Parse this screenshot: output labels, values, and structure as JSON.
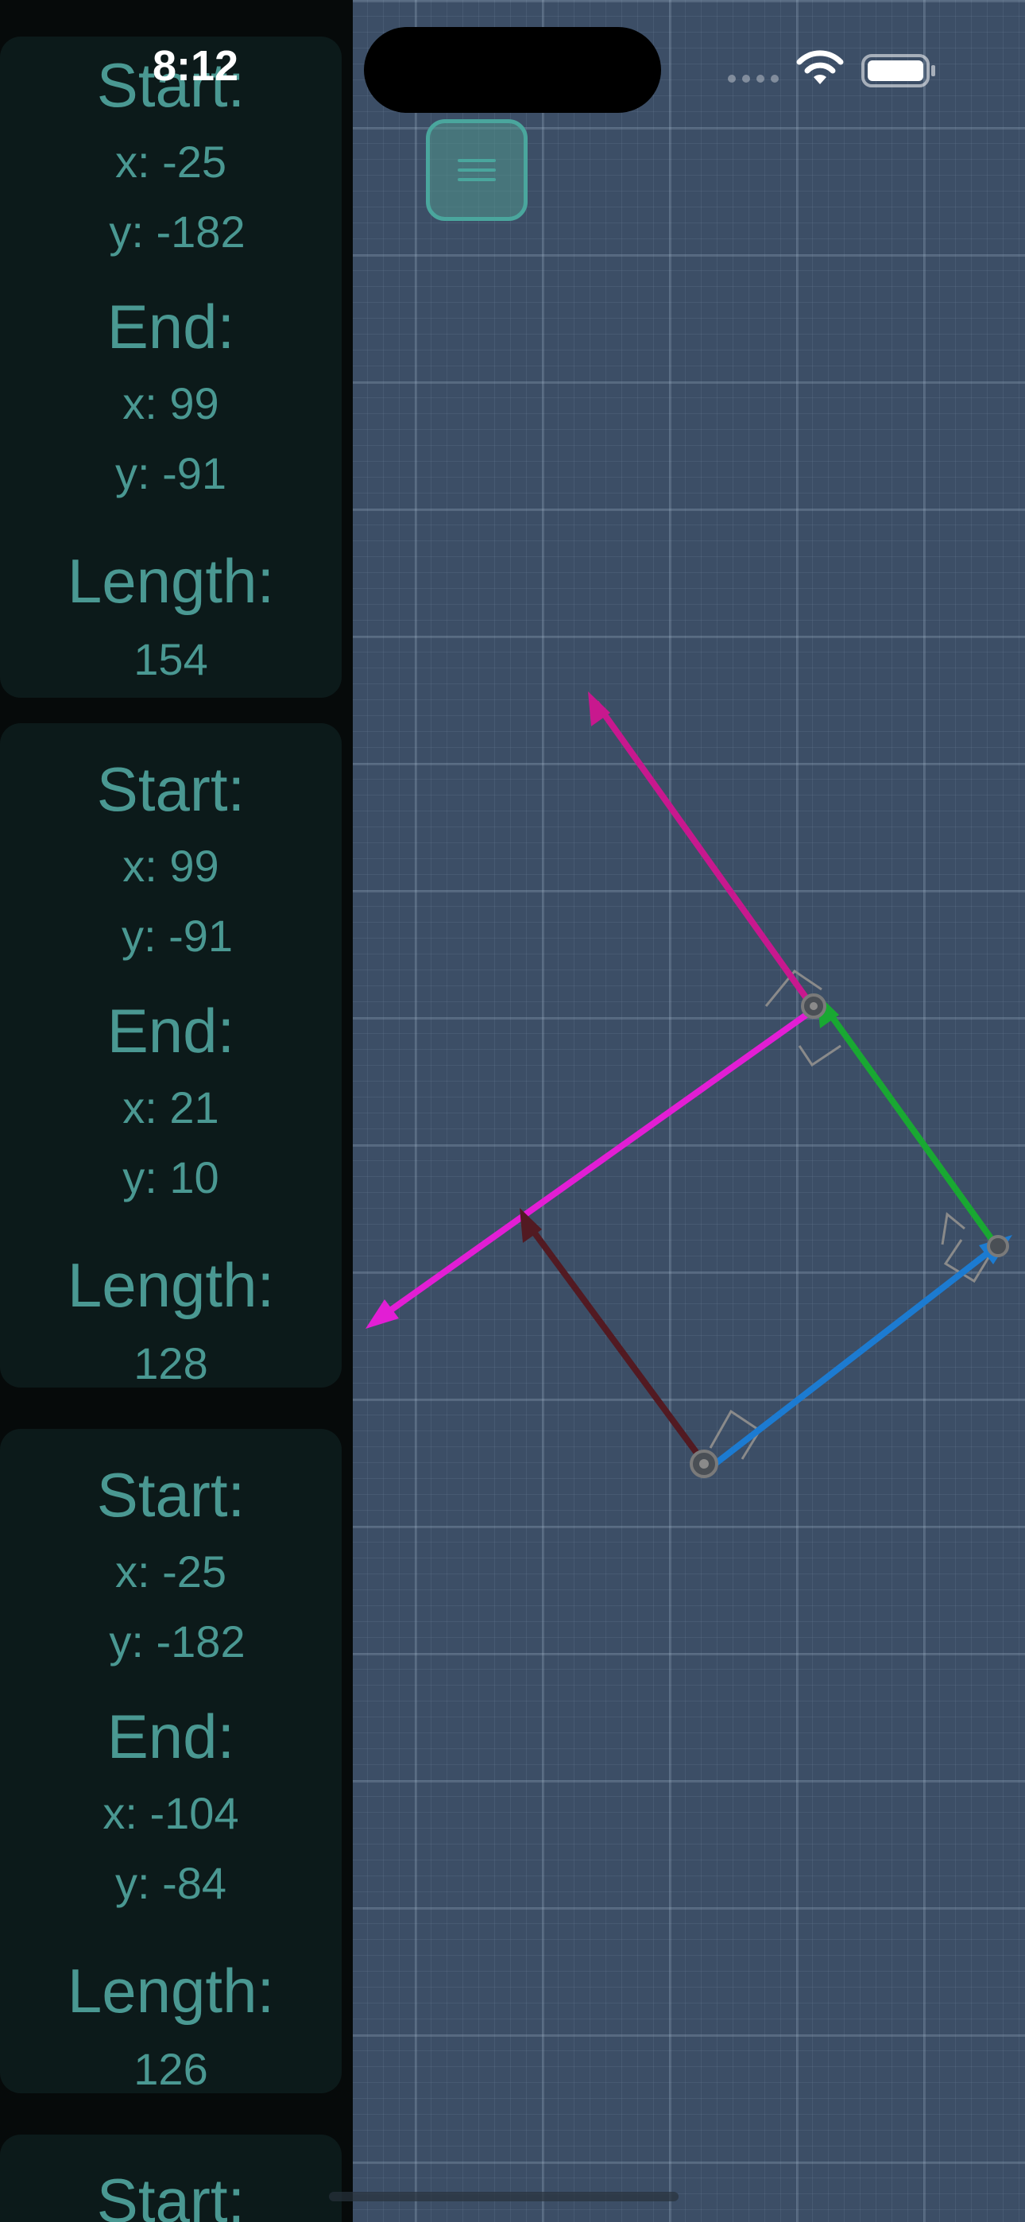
{
  "status_bar": {
    "time": "8:12"
  },
  "colors": {
    "accent": "#4a9892",
    "card_bg": "#0c1a1a",
    "canvas_bg": "#3c4e66",
    "vector_blue": "#1c7bd1",
    "vector_green": "#19a832",
    "vector_magenta": "#e21ed4",
    "vector_pink": "#c8188e",
    "vector_darkred": "#521a22"
  },
  "labels": {
    "start": "Start:",
    "end": "End:",
    "length": "Length:"
  },
  "segments": [
    {
      "start_x": "x: -25",
      "start_y": "y: -182",
      "end_x": "x: 99",
      "end_y": "y: -91",
      "length": "154"
    },
    {
      "start_x": "x: 99",
      "start_y": "y: -91",
      "end_x": "x: 21",
      "end_y": "y: 10",
      "length": "128"
    },
    {
      "start_x": "x: -25",
      "start_y": "y: -182",
      "end_x": "x: -104",
      "end_y": "y: -84",
      "length": "126"
    }
  ],
  "partial_card": {
    "start": "Start:"
  },
  "icons": [
    "menu-icon",
    "wifi-icon",
    "battery-icon"
  ]
}
